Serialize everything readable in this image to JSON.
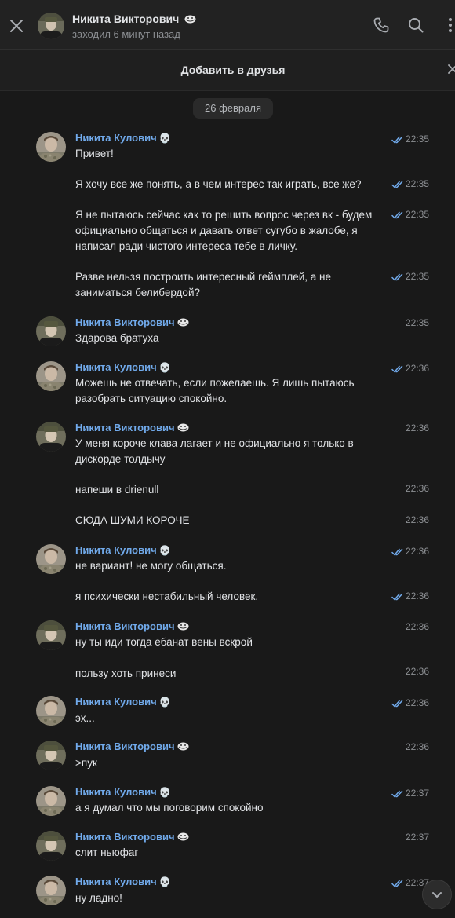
{
  "header": {
    "contact_name": "Никита Викторович",
    "contact_emoji": "trollface-emoji",
    "status": "заходил 6 минут назад",
    "icons": {
      "close": "close-icon",
      "call": "phone-icon",
      "search": "search-icon",
      "menu": "more-icon"
    }
  },
  "friend_bar": {
    "label": "Добавить в друзья",
    "close_icon": "close-icon"
  },
  "date_divider": "26 февраля",
  "colors": {
    "background": "#191919",
    "header_background": "#222222",
    "name_accent": "#71aaeb",
    "text": "#e1e3e6",
    "secondary_text": "#8c8f93",
    "read_check": "#71aaeb"
  },
  "authors": {
    "kulovich": {
      "name": "Никита Кулович",
      "emoji": "💀"
    },
    "viktorovich": {
      "name": "Никита Викторович",
      "emoji": "trollface-emoji"
    }
  },
  "messages": [
    {
      "author": "Никита Кулович",
      "text": "Привет!",
      "time": "22:35",
      "read": true
    },
    {
      "text": "Я хочу все же понять, а в чем интерес так играть, все же?",
      "time": "22:35",
      "read": true
    },
    {
      "text": "Я не пытаюсь сейчас как то решить вопрос через вк - будем официально общаться и давать ответ сугубо в жалобе, я написал ради чистого интереса тебе в личку.",
      "time": "22:35",
      "read": true
    },
    {
      "text": "Разве нельзя построить интересный геймплей, а не заниматься белибердой?",
      "time": "22:35",
      "read": true
    },
    {
      "author": "Никита Викторович",
      "text": "Здарова братуха",
      "time": "22:35",
      "read": false
    },
    {
      "author": "Никита Кулович",
      "text": "Можешь не отвечать, если пожелаешь. Я лишь пытаюсь разобрать ситуацию спокойно.",
      "time": "22:36",
      "read": true
    },
    {
      "author": "Никита Викторович",
      "text": "У меня короче клава лагает и не официально я только в дискорде толдычу",
      "time": "22:36",
      "read": false
    },
    {
      "text": "напеши в drienull",
      "time": "22:36",
      "read": false
    },
    {
      "text": "СЮДА ШУМИ КОРОЧЕ",
      "time": "22:36",
      "read": false
    },
    {
      "author": "Никита Кулович",
      "text": "не вариант! не могу общаться.",
      "time": "22:36",
      "read": true
    },
    {
      "text": "я психически нестабильный человек.",
      "time": "22:36",
      "read": true
    },
    {
      "author": "Никита Викторович",
      "text": "ну ты иди тогда ебанат вены вскрой",
      "time": "22:36",
      "read": false
    },
    {
      "text": "пользу хоть принеси",
      "time": "22:36",
      "read": false
    },
    {
      "author": "Никита Кулович",
      "text": "эх...",
      "time": "22:36",
      "read": true
    },
    {
      "author": "Никита Викторович",
      "text": ">пук",
      "time": "22:36",
      "read": false
    },
    {
      "author": "Никита Кулович",
      "text": "а я думал что мы поговорим спокойно",
      "time": "22:37",
      "read": true
    },
    {
      "author": "Никита Викторович",
      "text": "слит ньюфаг",
      "time": "22:37",
      "read": false
    },
    {
      "author": "Никита Кулович",
      "text": "ну ладно!",
      "time": "22:37",
      "read": true
    }
  ],
  "scroll_down_icon": "chevron-down-icon"
}
